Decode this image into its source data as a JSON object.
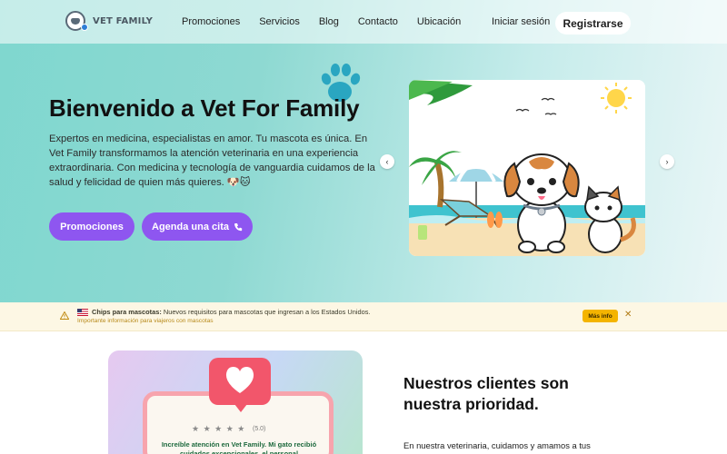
{
  "nav": {
    "logo_text": "VET FAMILY",
    "links": [
      "Promociones",
      "Servicios",
      "Blog",
      "Contacto",
      "Ubicación"
    ],
    "login": "Iniciar sesión",
    "register": "Registrarse"
  },
  "hero": {
    "title": "Bienvenido a Vet For Family",
    "description": "Expertos en medicina, especialistas en amor. Tu mascota es única. En Vet Family transformamos la atención veterinaria en una experiencia extraordinaria. Con medicina y tecnología de vanguardia cuidamos de la salud y felicidad de quien más quieres. 🐶🐱",
    "btn_promos": "Promociones",
    "btn_cita": "Agenda una cita",
    "phone_icon": "phone-icon",
    "carousel_prev": "‹",
    "carousel_next": "›"
  },
  "alert": {
    "title": "Chips para mascotas:",
    "message": " Nuevos requisitos para mascotas que ingresan a los Estados Unidos.",
    "sub": "Importante información para viajeros con mascotas",
    "more": "Más info",
    "close": "✕"
  },
  "testimonial": {
    "stars": "★ ★ ★ ★ ★",
    "rating": "(5.0)",
    "quote": "Increíble atención en Vet Family. Mi gato recibió cuidados excepcionales, el personal"
  },
  "section": {
    "title": "Nuestros clientes son nuestra prioridad.",
    "text": "En nuestra veterinaria, cuidamos y amamos a tus"
  },
  "colors": {
    "accent": "#8e56f0",
    "hero_teal": "#8ed9d2",
    "alert_bg": "#fdf7e4",
    "alert_button": "#f4b400"
  }
}
